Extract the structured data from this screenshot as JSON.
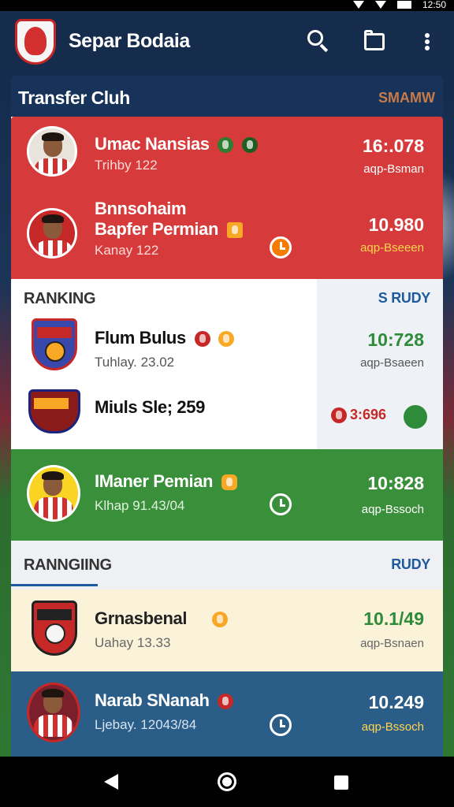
{
  "status_bar": {
    "time": "12:50"
  },
  "app_bar": {
    "title": "Separ Bodaia"
  },
  "sections": [
    {
      "label": "Transfer Cluh",
      "right": "SMAMW"
    },
    {
      "label": "RANKING",
      "right": "S RUDY"
    },
    {
      "label": "RANNGIING",
      "right": "RUDY"
    }
  ],
  "transfer_rows": [
    {
      "name": "Umac Nansias",
      "sub": "Trihby 122",
      "score": "16:.078",
      "season": "aqp-Bsman"
    },
    {
      "name_line1": "Bnnsohaim",
      "name_line2": "Bapfer Permian",
      "sub": "Kanay 122",
      "score": "10.980",
      "season": "aqp-Bseeen"
    }
  ],
  "ranking_rows": [
    {
      "name": "Flum Bulus",
      "sub": "Tuhlay. 23.02",
      "score": "10:728",
      "season": "aqp-Bsaeen"
    },
    {
      "name": "Miuls Sle; 259",
      "score": "3:696"
    }
  ],
  "green_row": {
    "name": "IManer Pemian",
    "sub": "Klhap 91.43/04",
    "score": "10:828",
    "season": "aqp-Bssoch"
  },
  "cream_row": {
    "name": "Grnasbenal",
    "sub": "Uahay 13.33",
    "score": "10.1/49",
    "season": "aqp-Bsnaen"
  },
  "blue_row": {
    "name": "Narab SNanah",
    "sub": "Ljebay. 12043/84",
    "score": "10.249",
    "season": "aqp-Bssoch"
  },
  "colors": {
    "red": "#d63a3a",
    "green": "#3a8f3a",
    "blue": "#2a5d87",
    "cream": "#fbf3d9",
    "score_green": "#2e8b3a",
    "accent_yellow": "#ffd54f"
  }
}
